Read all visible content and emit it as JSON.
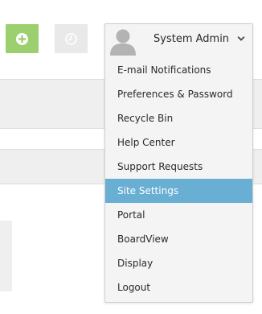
{
  "toolbar": {
    "add_icon": "plus-circle-icon",
    "clock_icon": "clock-icon",
    "add_color": "#9ccf6e"
  },
  "user_menu": {
    "user_name": "System Admin",
    "avatar_icon": "user-silhouette-icon",
    "toggle_icon": "chevron-down-icon",
    "highlight_color": "#69aed3",
    "items": [
      {
        "label": "E-mail Notifications",
        "active": false
      },
      {
        "label": "Preferences & Password",
        "active": false
      },
      {
        "label": "Recycle Bin",
        "active": false
      },
      {
        "label": "Help Center",
        "active": false
      },
      {
        "label": "Support Requests",
        "active": false
      },
      {
        "label": "Site Settings",
        "active": true
      },
      {
        "label": "Portal",
        "active": false
      },
      {
        "label": "BoardView",
        "active": false
      },
      {
        "label": "Display",
        "active": false
      },
      {
        "label": "Logout",
        "active": false
      }
    ]
  }
}
